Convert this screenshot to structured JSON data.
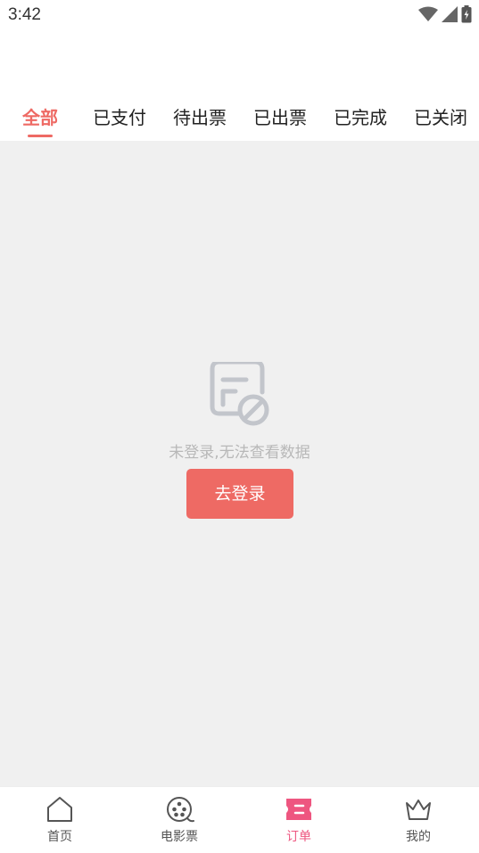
{
  "status_bar": {
    "time": "3:42"
  },
  "tabs": [
    {
      "label": "全部",
      "active": true
    },
    {
      "label": "已支付",
      "active": false
    },
    {
      "label": "待出票",
      "active": false
    },
    {
      "label": "已出票",
      "active": false
    },
    {
      "label": "已完成",
      "active": false
    },
    {
      "label": "已关闭",
      "active": false
    }
  ],
  "empty_state": {
    "icon": "document-blocked-icon",
    "message": "未登录,无法查看数据",
    "button_label": "去登录"
  },
  "bottom_nav": {
    "items": [
      {
        "label": "首页",
        "icon": "home-icon",
        "active": false
      },
      {
        "label": "电影票",
        "icon": "film-reel-icon",
        "active": false
      },
      {
        "label": "订单",
        "icon": "ticket-icon",
        "active": true
      },
      {
        "label": "我的",
        "icon": "crown-icon",
        "active": false
      }
    ]
  },
  "colors": {
    "accent": "#ee6a64",
    "nav_active": "#ee5680",
    "background": "#f0f0f0",
    "muted_text": "#b8b8b8"
  }
}
